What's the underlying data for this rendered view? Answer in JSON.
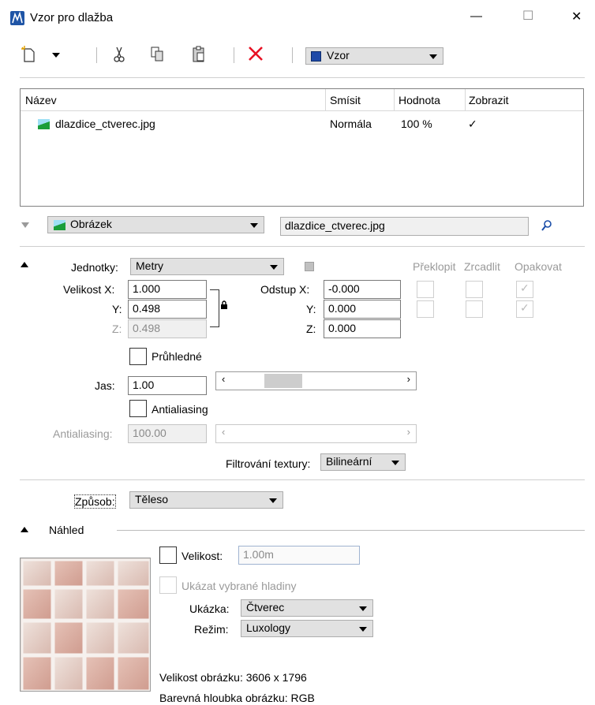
{
  "window": {
    "title": "Vzor pro dlažba",
    "minimize_glyph": "—",
    "maximize_glyph": "☐",
    "close_glyph": "✕"
  },
  "toolbar": {
    "combo_value": "Vzor",
    "icons": [
      "new-icon",
      "dropdown-arrow-icon",
      "cut-icon",
      "copy-icon",
      "paste-icon",
      "delete-icon"
    ]
  },
  "table": {
    "columns": [
      "Název",
      "Smísit",
      "Hodnota",
      "Zobrazit"
    ],
    "rows": [
      {
        "name": "dlazdice_ctverec.jpg",
        "blend": "Normála",
        "value": "100 %",
        "show": "✓"
      }
    ]
  },
  "map_bar": {
    "type_value": "Obrázek",
    "file_value": "dlazdice_ctverec.jpg"
  },
  "params": {
    "units_label": "Jednotky:",
    "units_value": "Metry",
    "flip_label": "Překlopit",
    "mirror_label": "Zrcadlit",
    "repeat_label": "Opakovat",
    "size_x_label": "Velikost X:",
    "size_x": "1.000",
    "size_y_label": "Y:",
    "size_y": "0.498",
    "size_z_label": "Z:",
    "size_z": "0.498",
    "offset_x_label": "Odstup X:",
    "offset_x": "-0.000",
    "offset_y_label": "Y:",
    "offset_y": "0.000",
    "offset_z_label": "Z:",
    "offset_z": "0.000",
    "transparent_label": "Průhledné",
    "brightness_label": "Jas:",
    "brightness_value": "1.00",
    "brightness_slider_fraction": 0.25,
    "antialias_check_label": "Antialiasing",
    "antialias_label": "Antialiasing:",
    "antialias_value": "100.00",
    "filter_label": "Filtrování textury:",
    "filter_value": "Bilineární",
    "scroll_left": "‹",
    "scroll_right": "›"
  },
  "method": {
    "label": "Způsob:",
    "value": "Těleso"
  },
  "preview": {
    "heading": "Náhled",
    "size_label": "Velikost:",
    "size_value": "1.00m",
    "show_layers_label": "Ukázat vybrané hladiny",
    "sample_label": "Ukázka:",
    "sample_value": "Čtverec",
    "mode_label": "Režim:",
    "mode_value": "Luxology",
    "image_size": "Velikost obrázku: 3606 x 1796",
    "color_depth": "Barevná hloubka obrázku: RGB"
  },
  "colors": {
    "delete_red": "#e81123",
    "table_border": "#828282",
    "separator": "#cfcfcf",
    "tile_base": "#e9d7cf",
    "tile_pink": "#dcb2a8"
  }
}
